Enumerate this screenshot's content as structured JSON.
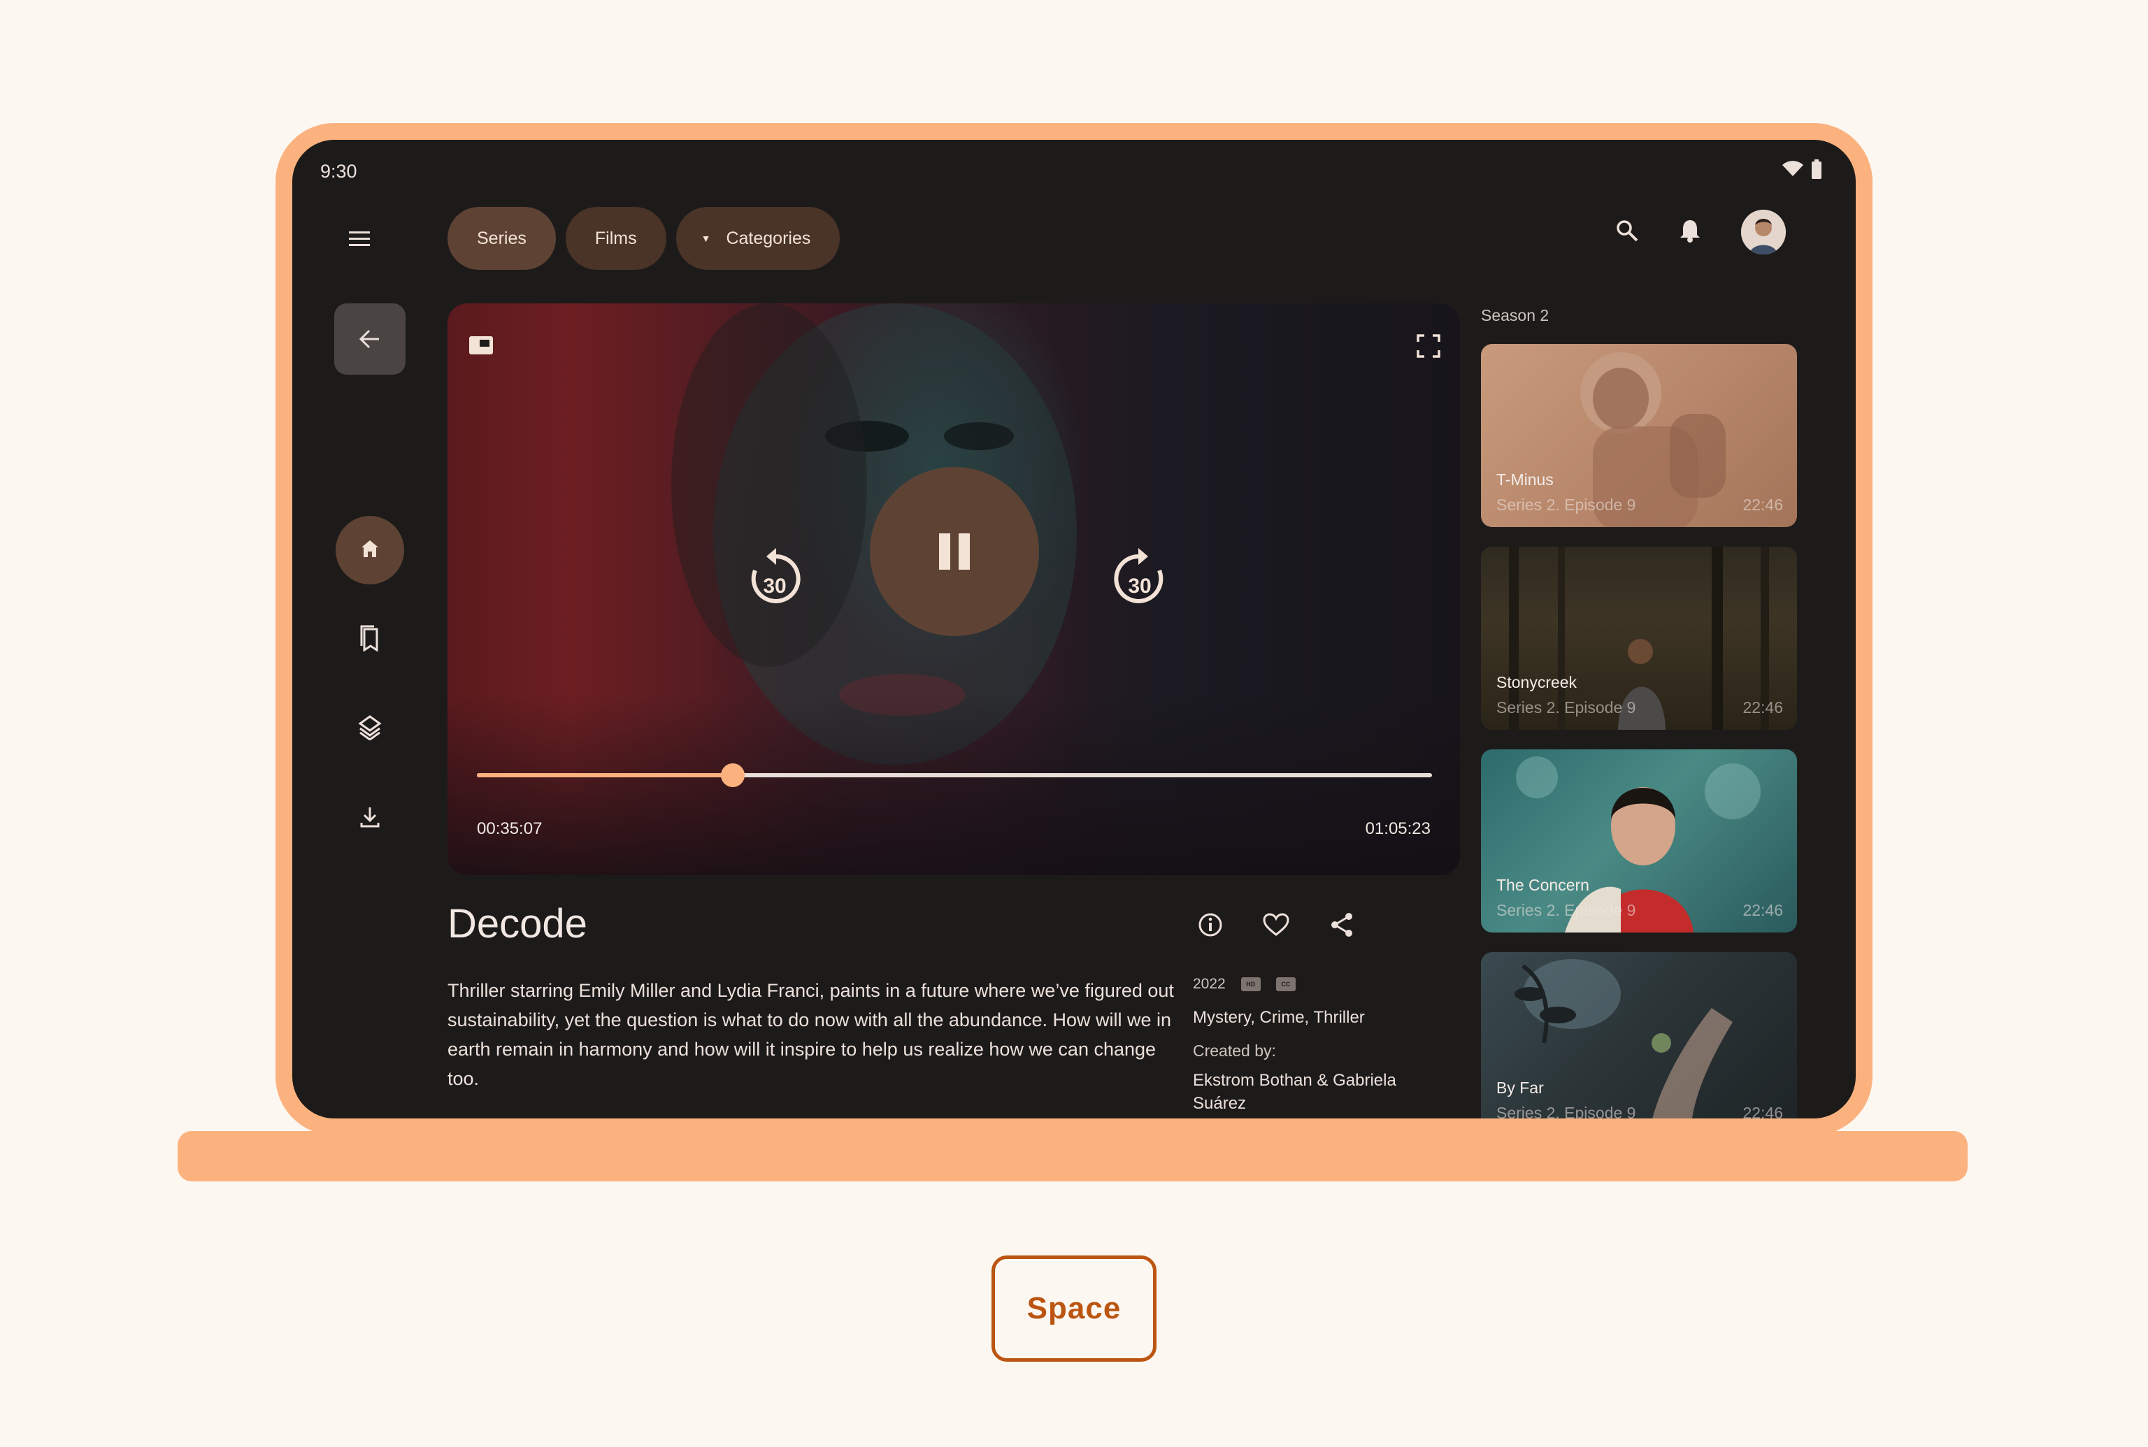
{
  "status_bar": {
    "time": "9:30"
  },
  "top_nav": {
    "chips": [
      {
        "label": "Series",
        "selected": true
      },
      {
        "label": "Films",
        "selected": false
      },
      {
        "label": "Categories",
        "selected": false,
        "dropdown": true
      }
    ],
    "actions": [
      "search-icon",
      "bell-icon",
      "avatar"
    ]
  },
  "rail": {
    "items": [
      "home-icon",
      "bookmark-icon",
      "layers-icon",
      "download-icon"
    ],
    "active": "home-icon"
  },
  "player": {
    "state": "playing",
    "rewind_seconds": "30",
    "forward_seconds": "30",
    "elapsed": "00:35:07",
    "total": "01:05:23",
    "progress": 0.268
  },
  "details": {
    "title": "Decode",
    "description": "Thriller starring Emily Miller and Lydia Franci, paints in a future where we’ve figured out sustainability, yet the question is what to do now with all the abundance. How will we in earth remain in harmony and how will it inspire to help us realize how we can change too.",
    "year": "2022",
    "badges": [
      "HD",
      "CC"
    ],
    "genres": "Mystery, Crime, Thriller",
    "created_label": "Created by:",
    "creators": "Ekstrom Bothan & Gabriela Suárez"
  },
  "season": {
    "label": "Season 2",
    "episodes": [
      {
        "title": "T-Minus",
        "subtitle": "Series 2. Episode 9",
        "duration": "22:46"
      },
      {
        "title": "Stonycreek",
        "subtitle": "Series 2. Episode 9",
        "duration": "22:46"
      },
      {
        "title": "The Concern",
        "subtitle": "Series 2. Episode 9",
        "duration": "22:46"
      },
      {
        "title": "By Far",
        "subtitle": "Series 2. Episode 9",
        "duration": "22:46"
      }
    ]
  },
  "key_hint": {
    "label": "Space"
  },
  "colors": {
    "accent": "#fcb27f",
    "chip": "#4a3428",
    "chip_selected": "#5e4334",
    "screen_bg": "#1d1b1a",
    "key_outline": "#bb5511"
  }
}
